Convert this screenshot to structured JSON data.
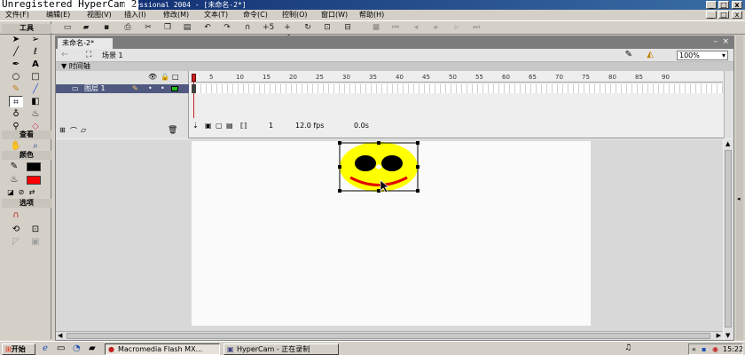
{
  "window": {
    "watermark": "Unregistered HyperCam 2",
    "title_rest": "rofessional 2004 - [未命名-2*]",
    "minimize": "_",
    "restore": "□",
    "close": "x"
  },
  "menu": [
    "文件(F)",
    "编辑(E)",
    "视图(V)",
    "插入(I)",
    "修改(M)",
    "文本(T)",
    "命令(C)",
    "控制(O)",
    "窗口(W)",
    "帮助(H)"
  ],
  "tools": {
    "header": "工具",
    "view_header": "查看",
    "colors_header": "颜色",
    "options_header": "选项"
  },
  "document": {
    "tab": "未命名-2*",
    "scene": "场景 1",
    "zoom": "100%",
    "timeline_label": "时间轴",
    "layer_name": "图层 1",
    "ruler": [
      "1",
      "5",
      "10",
      "15",
      "20",
      "25",
      "30",
      "35",
      "40",
      "45",
      "50",
      "55",
      "60",
      "65",
      "70",
      "75",
      "80",
      "85",
      "90"
    ],
    "current_frame": "1",
    "frame_rate": "12.0 fps",
    "elapsed": "0.0s"
  },
  "colors": {
    "stroke": "#000000",
    "fill": "#ff0000",
    "face": "#ffff00",
    "smile": "#e00000"
  },
  "taskbar": {
    "start": "开始",
    "tasks": [
      "Macromedia Flash MX...",
      "HyperCam - 正在录制"
    ],
    "clock": "15:22"
  }
}
